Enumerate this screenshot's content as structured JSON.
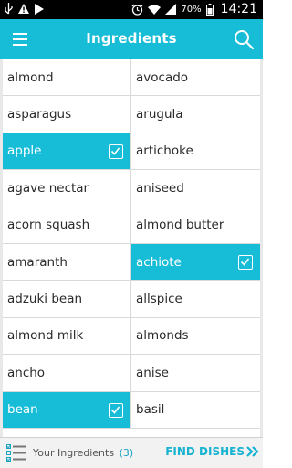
{
  "status_bar": {
    "battery": "70%",
    "time": "14:21"
  },
  "app_bar": {
    "title": "Ingredients",
    "menu_icon": "hamburger-menu-icon",
    "search_icon": "search-icon"
  },
  "ingredients": [
    {
      "left": "almond",
      "left_selected": false,
      "right": "avocado",
      "right_selected": false
    },
    {
      "left": "asparagus",
      "left_selected": false,
      "right": "arugula",
      "right_selected": false
    },
    {
      "left": "apple",
      "left_selected": true,
      "right": "artichoke",
      "right_selected": false
    },
    {
      "left": "agave nectar",
      "left_selected": false,
      "right": "aniseed",
      "right_selected": false
    },
    {
      "left": "acorn squash",
      "left_selected": false,
      "right": "almond butter",
      "right_selected": false
    },
    {
      "left": "amaranth",
      "left_selected": false,
      "right": "achiote",
      "right_selected": true
    },
    {
      "left": "adzuki bean",
      "left_selected": false,
      "right": "allspice",
      "right_selected": false
    },
    {
      "left": "almond milk",
      "left_selected": false,
      "right": "almonds",
      "right_selected": false
    },
    {
      "left": "ancho",
      "left_selected": false,
      "right": "anise",
      "right_selected": false
    },
    {
      "left": "bean",
      "left_selected": true,
      "right": "basil",
      "right_selected": false
    }
  ],
  "bottom_bar": {
    "your_ingredients_label": "Your Ingredients",
    "count": "(3)",
    "find_dishes_label": "FIND DISHES",
    "find_dishes_icon": "double-chevron-right-icon"
  },
  "colors": {
    "accent": "#17bcd7",
    "status_bar": "#000000",
    "selected_text": "#ffffff"
  }
}
